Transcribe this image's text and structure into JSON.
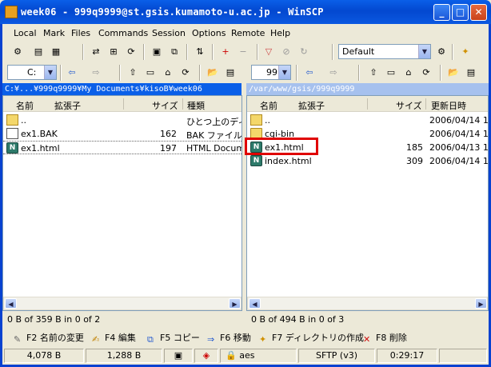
{
  "window": {
    "title": "week06 - 999q9999@st.gsis.kumamoto-u.ac.jp - WinSCP"
  },
  "menu": [
    "Local",
    "Mark",
    "Files",
    "Commands",
    "Session",
    "Options",
    "Remote",
    "Help"
  ],
  "toolbar": {
    "profile": "Default"
  },
  "left": {
    "drive": "C:",
    "path": "C:¥...¥999q9999¥My Documents¥kisoB¥week06",
    "columns": [
      "名前",
      "拡張子",
      "サイズ",
      "種類"
    ],
    "rows": [
      {
        "name": "..",
        "size": "",
        "type": "ひとつ上のディレ",
        "icon": "parent-folder-icon"
      },
      {
        "name": "ex1.BAK",
        "size": "162",
        "type": "BAK ファイル",
        "icon": "bak-file-icon"
      },
      {
        "name": "ex1.html",
        "size": "197",
        "type": "HTML Docume",
        "icon": "html-file-icon"
      }
    ],
    "status": "0 B of 359 B in 0 of 2"
  },
  "right": {
    "drive": "99",
    "path": "/var/www/gsis/999q9999",
    "columns": [
      "名前",
      "拡張子",
      "サイズ",
      "更新日時"
    ],
    "rows": [
      {
        "name": "..",
        "size": "",
        "date": "2006/04/14 1",
        "icon": "parent-folder-icon"
      },
      {
        "name": "cgi-bin",
        "size": "",
        "date": "2006/04/14 1",
        "icon": "folder-icon"
      },
      {
        "name": "ex1.html",
        "size": "185",
        "date": "2006/04/13 1",
        "icon": "html-file-icon"
      },
      {
        "name": "index.html",
        "size": "309",
        "date": "2006/04/14 1",
        "icon": "html-file-icon"
      }
    ],
    "status": "0 B of 494 B in 0 of 3"
  },
  "fkeys": [
    {
      "label": "F2 名前の変更",
      "icon": "rename-icon"
    },
    {
      "label": "F4 編集",
      "icon": "edit-icon"
    },
    {
      "label": "F5 コピー",
      "icon": "copy-icon"
    },
    {
      "label": "F6 移動",
      "icon": "move-icon"
    },
    {
      "label": "F7 ディレクトリの作成",
      "icon": "new-folder-icon"
    },
    {
      "label": "F8 削除",
      "icon": "delete-icon"
    }
  ],
  "statusbar": {
    "uploaded": "4,078 B",
    "downloaded": "1,288 B",
    "cipher": "aes",
    "protocol": "SFTP (v3)",
    "time": "0:29:17"
  },
  "colors": {
    "titlebar": "#0a5fe8",
    "highlight": "#e00000",
    "accent_path": "#0a5fe8"
  }
}
